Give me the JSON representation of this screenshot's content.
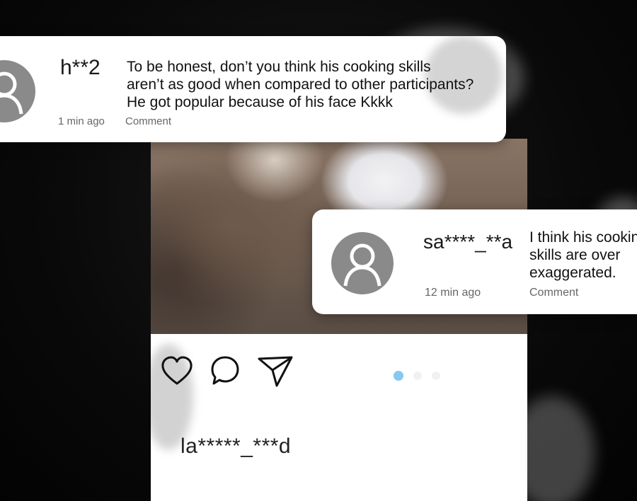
{
  "comments": [
    {
      "username": "h**2",
      "text_lines": [
        "To be honest, don’t you think his cooking skills",
        "aren’t as good when compared to other participants?",
        "He got popular because of his face Kkkk"
      ],
      "time": "1 min ago",
      "action": "Comment"
    },
    {
      "username": "sa****_**a",
      "text_lines": [
        "I think his cookin",
        "skills are over",
        "exaggerated."
      ],
      "time": "12 min ago",
      "action": "Comment"
    }
  ],
  "post": {
    "username": "la*****_***d",
    "actions": [
      "heart-icon",
      "comment-icon",
      "send-icon"
    ],
    "carousel": {
      "count": 3,
      "active_index": 0,
      "active_color": "#86c9ee"
    }
  },
  "icons": {
    "avatar": "user-silhouette-icon"
  }
}
